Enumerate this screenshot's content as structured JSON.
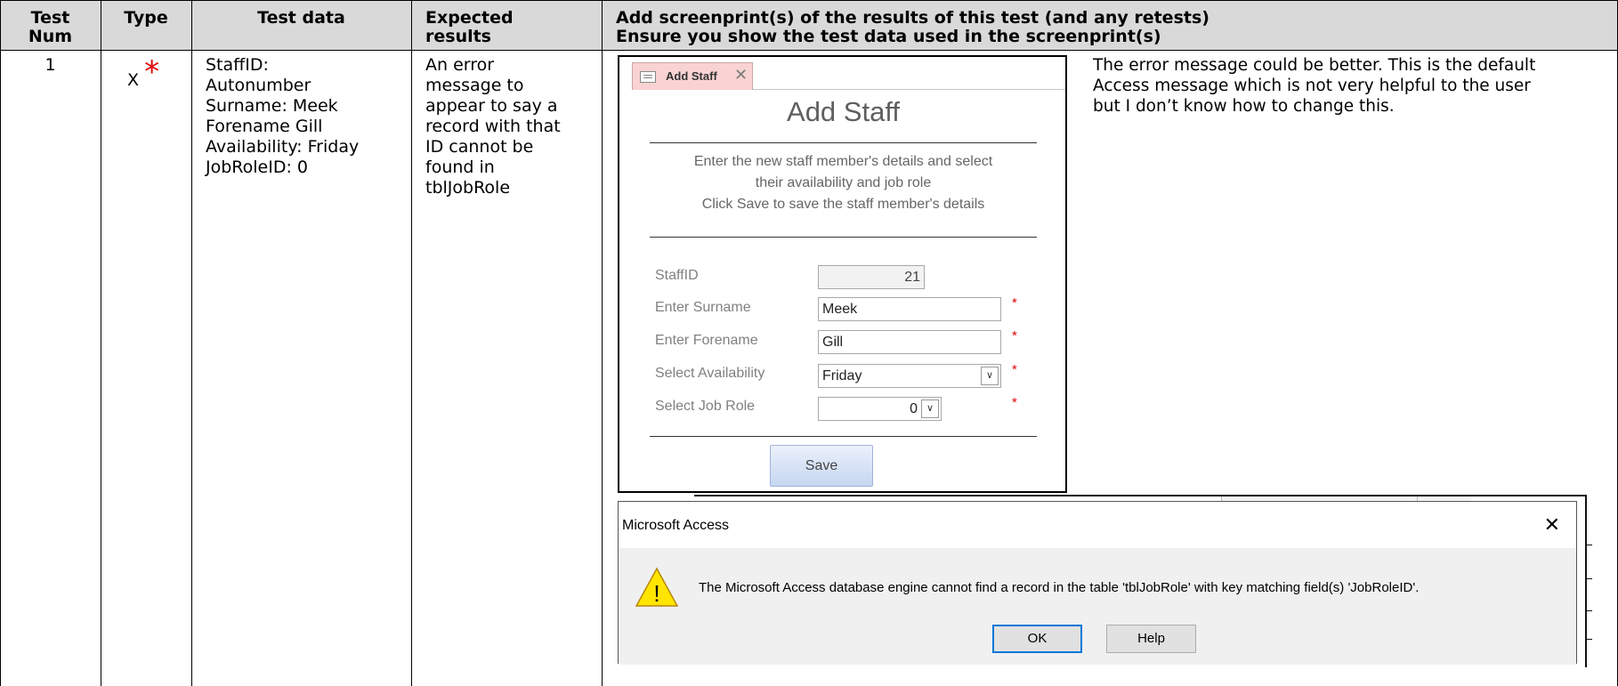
{
  "table": {
    "headers": {
      "test_num_1": "Test",
      "test_num_2": "Num",
      "type": "Type",
      "test_data": "Test data",
      "expected_1": "Expected",
      "expected_2": "results",
      "screenprint_1": "Add screenprint(s) of the results of this test (and any retests)",
      "screenprint_2": "Ensure you show the test data used in the screenprint(s)"
    },
    "row": {
      "num": "1",
      "type": "X",
      "type_star": "*",
      "test_data_lines": [
        "StaffID:",
        "Autonumber",
        "Surname: Meek",
        "Forename Gill",
        "Availability: Friday",
        "JobRoleID: 0"
      ],
      "expected_lines": [
        "An error",
        "message to",
        "appear to say a",
        "record with that",
        "ID cannot be",
        "found in",
        "tblJobRole"
      ],
      "comment_lines": [
        "The error message could be better. This is the default",
        "Access message which is not very helpful to the user",
        "but I don’t know how to change this."
      ]
    }
  },
  "form": {
    "tab_label": "Add Staff",
    "tab_close": "✕",
    "title": "Add Staff",
    "instructions": [
      "Enter the new staff member's details and select",
      "their availability and job role",
      "Click Save to save the staff member's details"
    ],
    "fields": {
      "staff_id": {
        "label": "StaffID",
        "value": "21"
      },
      "surname": {
        "label": "Enter Surname",
        "value": "Meek"
      },
      "forename": {
        "label": "Enter Forename",
        "value": "Gill"
      },
      "availability": {
        "label": "Select Availability",
        "value": "Friday"
      },
      "job_role": {
        "label": "Select Job Role",
        "value": "0"
      }
    },
    "required_marker": "*",
    "dropdown_glyph": "∨",
    "save_label": "Save"
  },
  "dialog": {
    "title": "Microsoft Access",
    "close": "✕",
    "message": "The Microsoft Access database engine cannot find a record in the table 'tblJobRole' with key matching field(s) 'JobRoleID'.",
    "warning_glyph": "!",
    "ok_label": "OK",
    "help_label": "Help",
    "colors": {
      "warning_fill": "#ffe500",
      "ok_border": "#0078d7"
    }
  },
  "colors": {
    "header_bg": "#d9d9d9",
    "required": "#e00000",
    "tab_bg": "#f9d3d3"
  }
}
